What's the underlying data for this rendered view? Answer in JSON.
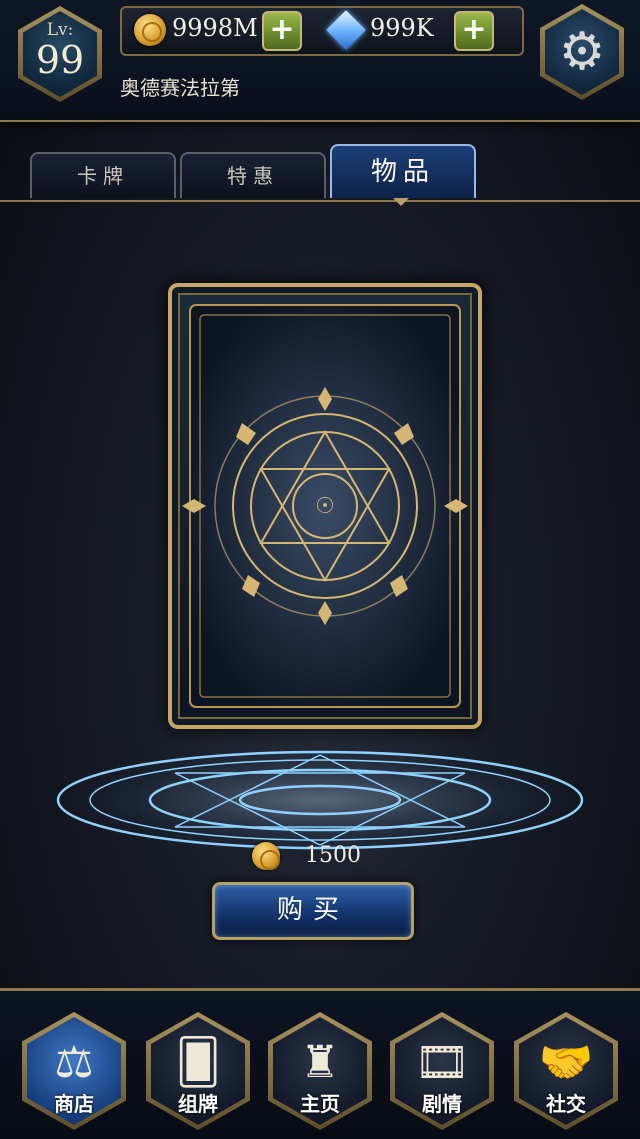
{
  "player": {
    "level_label": "Lv:",
    "level_value": "99",
    "name": "奥德赛法拉第"
  },
  "currency": {
    "gold": "9998M",
    "gems": "999K",
    "add_symbol": "+"
  },
  "settings": {
    "icon": "gear-icon",
    "glyph": "⚙"
  },
  "tabs": [
    {
      "label": "卡牌"
    },
    {
      "label": "特惠"
    },
    {
      "label": "物品"
    }
  ],
  "active_tab": "物品",
  "shop_item": {
    "price": "1500",
    "buy_label": "购买"
  },
  "nav": [
    {
      "label": "商店",
      "icon": "scales-icon",
      "glyph": "⚖"
    },
    {
      "label": "组牌",
      "icon": "cards-icon",
      "glyph": "🂠"
    },
    {
      "label": "主页",
      "icon": "castle-icon",
      "glyph": "♜"
    },
    {
      "label": "剧情",
      "icon": "film-icon",
      "glyph": "🎞"
    },
    {
      "label": "社交",
      "icon": "handshake-icon",
      "glyph": "🤝"
    }
  ],
  "colors": {
    "gold_trim": "#c6a660",
    "active_blue": "#1d3f78",
    "glow": "#7fc4ff"
  }
}
